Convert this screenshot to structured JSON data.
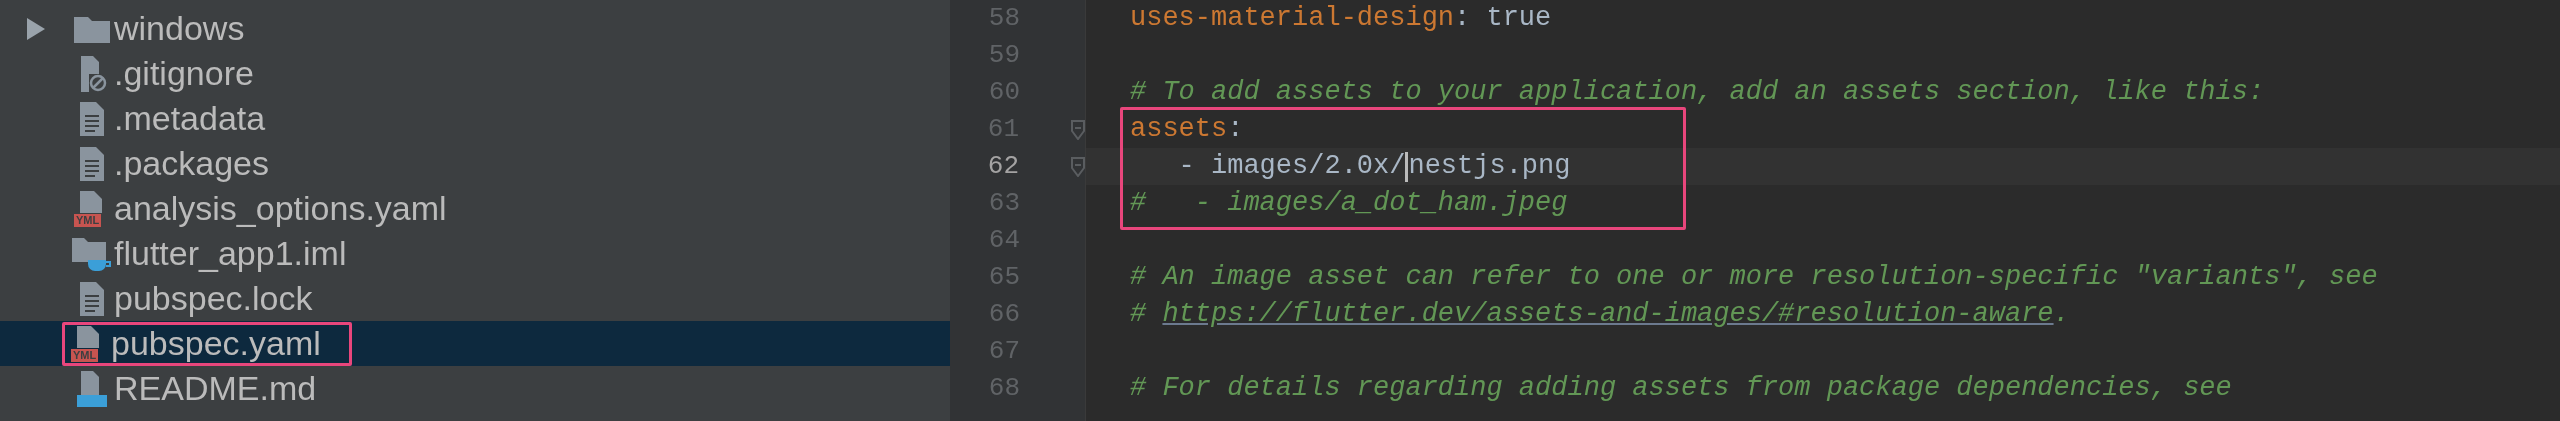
{
  "project_tree": {
    "items": [
      {
        "kind": "folder",
        "name": "windows",
        "expanded": false,
        "selected": false
      },
      {
        "kind": "ignore",
        "name": ".gitignore",
        "selected": false
      },
      {
        "kind": "text",
        "name": ".metadata",
        "selected": false
      },
      {
        "kind": "text",
        "name": ".packages",
        "selected": false
      },
      {
        "kind": "yaml",
        "name": "analysis_options.yaml",
        "badge": "YML",
        "selected": false
      },
      {
        "kind": "module",
        "name": "flutter_app1.iml",
        "selected": false
      },
      {
        "kind": "text",
        "name": "pubspec.lock",
        "selected": false
      },
      {
        "kind": "yaml",
        "name": "pubspec.yaml",
        "badge": "YML",
        "selected": true,
        "boxed": true
      },
      {
        "kind": "markdown",
        "name": "README.md",
        "selected": false
      }
    ]
  },
  "editor": {
    "blocks": [
      {
        "lines": [
          {
            "number": "58",
            "current": false,
            "tokens": [
              {
                "kind": "key",
                "text": "uses-material-design"
              },
              {
                "kind": "plain",
                "text": ": true"
              }
            ]
          },
          {
            "number": "59",
            "current": false
          },
          {
            "number": "60",
            "current": false,
            "tokens": [
              {
                "kind": "comment",
                "text": "# To add assets to your application, add an assets section, like this:"
              }
            ]
          }
        ]
      },
      {
        "boxed": true,
        "lines": [
          {
            "number": "61",
            "current": false,
            "fold": true,
            "tokens": [
              {
                "kind": "key",
                "text": "assets"
              },
              {
                "kind": "plain",
                "text": ":"
              }
            ]
          },
          {
            "number": "62",
            "current": true,
            "fold": true,
            "tokens": [
              {
                "kind": "plain",
                "text": "   - images/2.0x/"
              },
              {
                "kind": "caret"
              },
              {
                "kind": "plain",
                "text": "nestjs.png"
              }
            ]
          },
          {
            "number": "63",
            "current": false,
            "tokens": [
              {
                "kind": "comment",
                "text": "#   - images/a_dot_ham.jpeg"
              }
            ]
          }
        ]
      },
      {
        "lines": [
          {
            "number": "64",
            "current": false
          },
          {
            "number": "65",
            "current": false,
            "tokens": [
              {
                "kind": "comment",
                "text": "# An image asset can refer to one or more resolution-specific \"variants\", see"
              }
            ]
          },
          {
            "number": "66",
            "current": false,
            "tokens": [
              {
                "kind": "comment",
                "text": "# "
              },
              {
                "kind": "link",
                "text": "https://flutter.dev/assets-and-images/#resolution-aware"
              },
              {
                "kind": "comment",
                "text": "."
              }
            ]
          },
          {
            "number": "67",
            "current": false
          },
          {
            "number": "68",
            "current": false,
            "tokens": [
              {
                "kind": "comment",
                "text": "# For details regarding adding assets from package dependencies, see"
              }
            ]
          }
        ]
      }
    ]
  }
}
